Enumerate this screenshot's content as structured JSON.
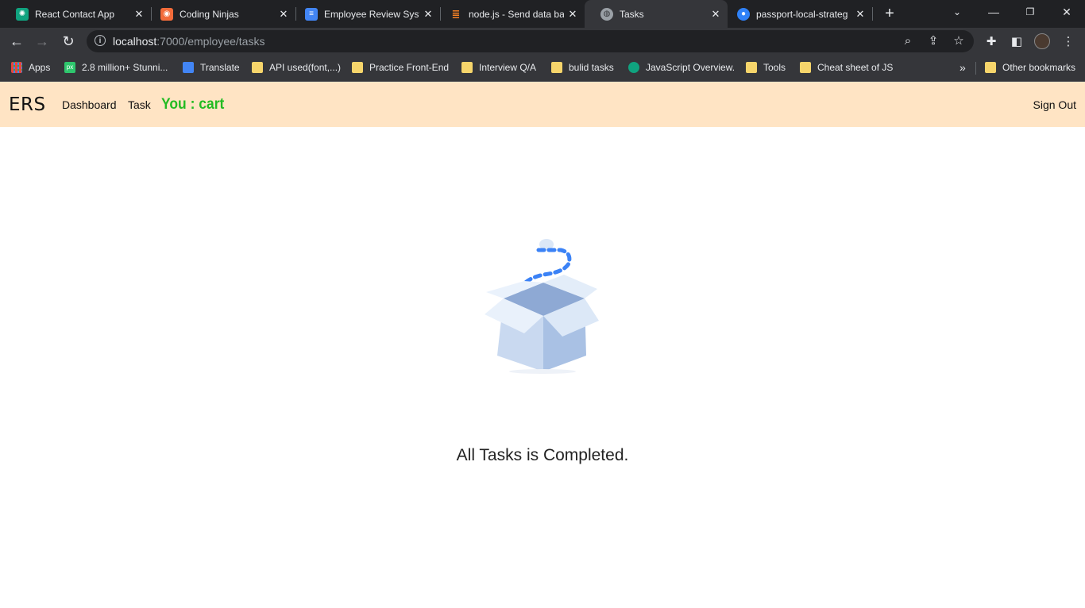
{
  "browser": {
    "tabs": [
      {
        "title": "React Contact App",
        "favicon": "openai-icon",
        "color": "#10a37f"
      },
      {
        "title": "Coding Ninjas",
        "favicon": "ninja-icon",
        "color": "#f26b3a"
      },
      {
        "title": "Employee Review Syst",
        "favicon": "docs-icon",
        "color": "#4285f4"
      },
      {
        "title": "node.js - Send data ba",
        "favicon": "stackoverflow-icon",
        "color": "#f48024"
      },
      {
        "title": "Tasks",
        "favicon": "globe-icon",
        "color": "#9aa0a6"
      },
      {
        "title": "passport-local-strateg",
        "favicon": "github-icon",
        "color": "#2f81f7"
      }
    ],
    "active_tab": 4,
    "url_host": "localhost",
    "url_rest": ":7000/employee/tasks",
    "bookmarks": [
      {
        "label": "Apps",
        "icon": "apps-grid-icon"
      },
      {
        "label": "2.8 million+ Stunni...",
        "icon": "pixabay-icon"
      },
      {
        "label": "Translate",
        "icon": "translate-icon"
      },
      {
        "label": "API used(font,...)",
        "icon": "folder-icon"
      },
      {
        "label": "Practice Front-End",
        "icon": "folder-icon"
      },
      {
        "label": "Interview Q/A",
        "icon": "folder-icon"
      },
      {
        "label": "bulid tasks",
        "icon": "folder-icon"
      },
      {
        "label": "JavaScript Overview.",
        "icon": "openai-icon"
      },
      {
        "label": "Tools",
        "icon": "folder-icon"
      },
      {
        "label": "Cheat sheet of JS",
        "icon": "folder-icon"
      }
    ],
    "overflow_label": "»",
    "other_bookmarks": "Other bookmarks"
  },
  "app": {
    "brand": "ERS",
    "nav": {
      "dashboard": "Dashboard",
      "task": "Task"
    },
    "user_label": "You : cart",
    "sign_out": "Sign Out",
    "message": "All Tasks is Completed."
  }
}
